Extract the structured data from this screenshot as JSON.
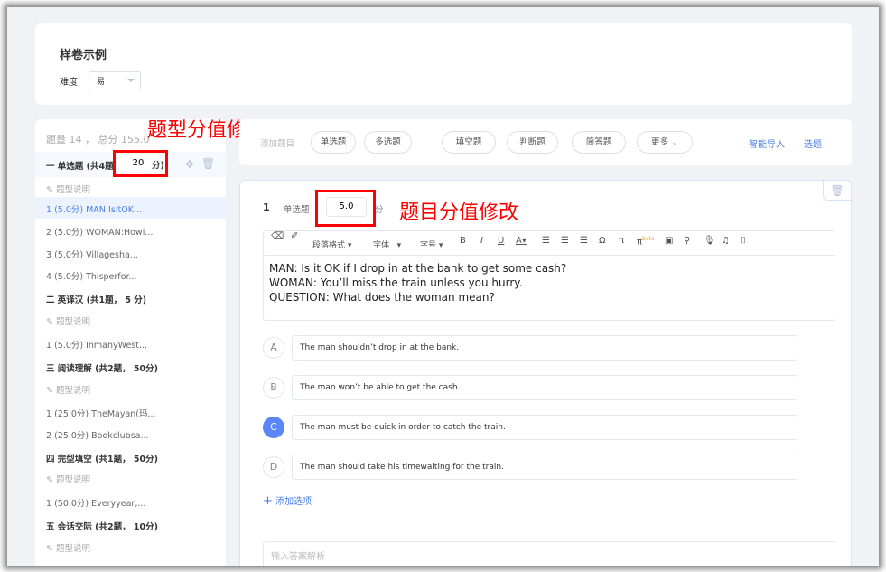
{
  "header": {
    "title": "样卷示例",
    "difficulty_label": "难度",
    "difficulty_value": "易"
  },
  "summary": "题量 14 ， 总分 155.0",
  "sections": [
    {
      "title": "一 单选题 (共4题",
      "score": "20",
      "unit": "分)",
      "desc": "题型说明",
      "items": [
        "1 (5.0分) MAN:IsitOK...",
        "2 (5.0分) WOMAN:Howi...",
        "3 (5.0分) Villagesha...",
        "4 (5.0分) Thisperfor..."
      ]
    },
    {
      "title": "二 英译汉 (共1题， 5 分)",
      "desc": "题型说明",
      "items": [
        "1 (5.0分) InmanyWest..."
      ]
    },
    {
      "title": "三 阅读理解 (共2题， 50分)",
      "desc": "题型说明",
      "items": [
        "1 (25.0分) TheMayan(玛...",
        "2 (25.0分) Bookclubsa..."
      ]
    },
    {
      "title": "四 完型填空 (共1题， 50分)",
      "desc": "题型说明",
      "items": [
        "1 (50.0分) Everyyear,..."
      ]
    },
    {
      "title": "五 会话交际 (共2题， 10分)",
      "desc": "题型说明",
      "items": []
    }
  ],
  "toolbar": {
    "add_label": "添加题目",
    "types": [
      "单选题",
      "多选题",
      "填空题",
      "判断题",
      "简答题",
      "更多"
    ],
    "smart_import": "智能导入",
    "pick": "选题"
  },
  "question": {
    "number": "1",
    "type": "单选题",
    "score": "5.0",
    "unit": "分",
    "editor_tools": {
      "para": "段落格式",
      "font": "字体",
      "size": "字号",
      "beta": "beta"
    },
    "stem": [
      "MAN: Is it OK if I drop in at the bank to get some cash?",
      "WOMAN: You’ll miss the train unless you hurry.",
      "QUESTION: What does the woman mean?"
    ],
    "options": [
      {
        "letter": "A",
        "text": "The man shouldn’t drop in at the bank."
      },
      {
        "letter": "B",
        "text": "The man won’t be able to get the cash."
      },
      {
        "letter": "C",
        "text": "The man must be quick in order to catch the train.",
        "correct": true
      },
      {
        "letter": "D",
        "text": "The man should take his timewaiting for the train."
      }
    ],
    "add_option": "添加选项",
    "analysis_placeholder": "输入答案解析"
  },
  "annotations": {
    "type_score": "题型分值修改",
    "question_score": "题目分值修改"
  },
  "colors": {
    "accent": "#4a7fe8",
    "annotation": "#ff0000"
  }
}
